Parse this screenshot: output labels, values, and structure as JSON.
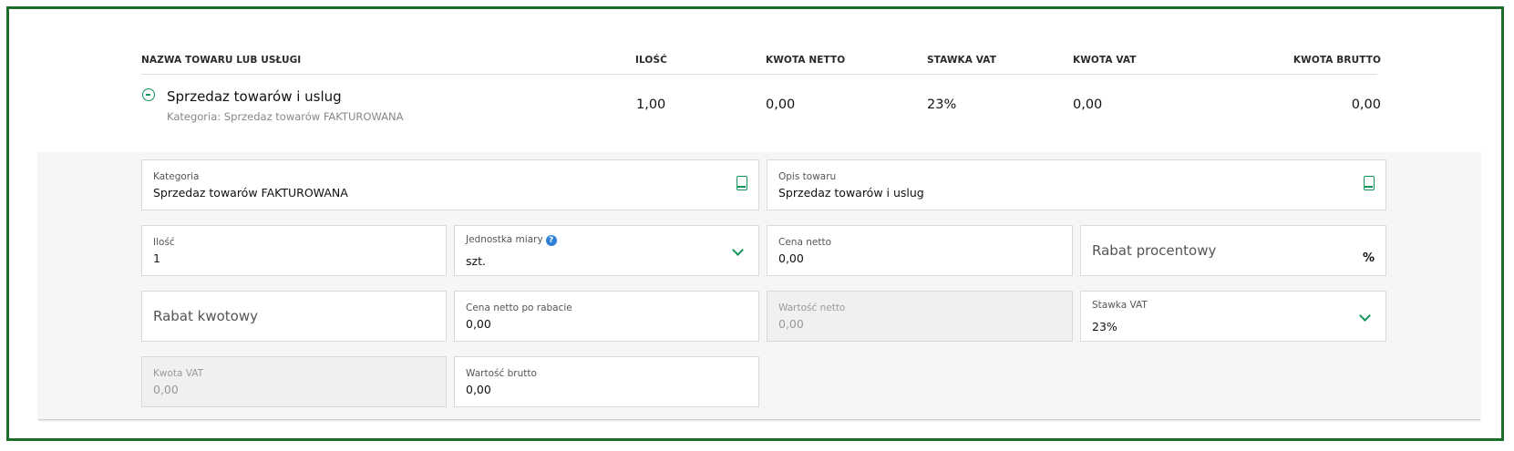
{
  "table": {
    "headers": {
      "name": "NAZWA TOWARU LUB USŁUGI",
      "qty": "ILOŚĆ",
      "net_amount": "KWOTA NETTO",
      "vat_rate": "STAWKA VAT",
      "vat_amount": "KWOTA VAT",
      "gross_amount": "KWOTA BRUTTO"
    },
    "row": {
      "name": "Sprzedaz towarów i uslug",
      "category": "Kategoria: Sprzedaz towarów FAKTUROWANA",
      "qty": "1,00",
      "net_amount": "0,00",
      "vat_rate": "23%",
      "vat_amount": "0,00",
      "gross_amount": "0,00"
    }
  },
  "form": {
    "category": {
      "label": "Kategoria",
      "value": "Sprzedaz towarów FAKTUROWANA",
      "icon": "book-icon"
    },
    "description": {
      "label": "Opis towaru",
      "value": "Sprzedaz towarów i uslug",
      "icon": "book-icon"
    },
    "quantity": {
      "label": "Ilość",
      "value": "1"
    },
    "unit": {
      "label": "Jednostka miary",
      "help": "?",
      "value": "szt."
    },
    "net_price": {
      "label": "Cena netto",
      "value": "0,00"
    },
    "percent_discount": {
      "placeholder": "Rabat procentowy",
      "suffix": "%"
    },
    "amount_discount": {
      "placeholder": "Rabat kwotowy"
    },
    "net_price_after_discount": {
      "label": "Cena netto po rabacie",
      "value": "0,00"
    },
    "net_value": {
      "label": "Wartość netto",
      "value": "0,00"
    },
    "vat_rate": {
      "label": "Stawka VAT",
      "value": "23%"
    },
    "vat_amount": {
      "label": "Kwota VAT",
      "value": "0,00"
    },
    "gross_value": {
      "label": "Wartość brutto",
      "value": "0,00"
    }
  },
  "colors": {
    "frame": "#1b6e2a",
    "accent": "#11965a",
    "help": "#2f7fd8"
  }
}
